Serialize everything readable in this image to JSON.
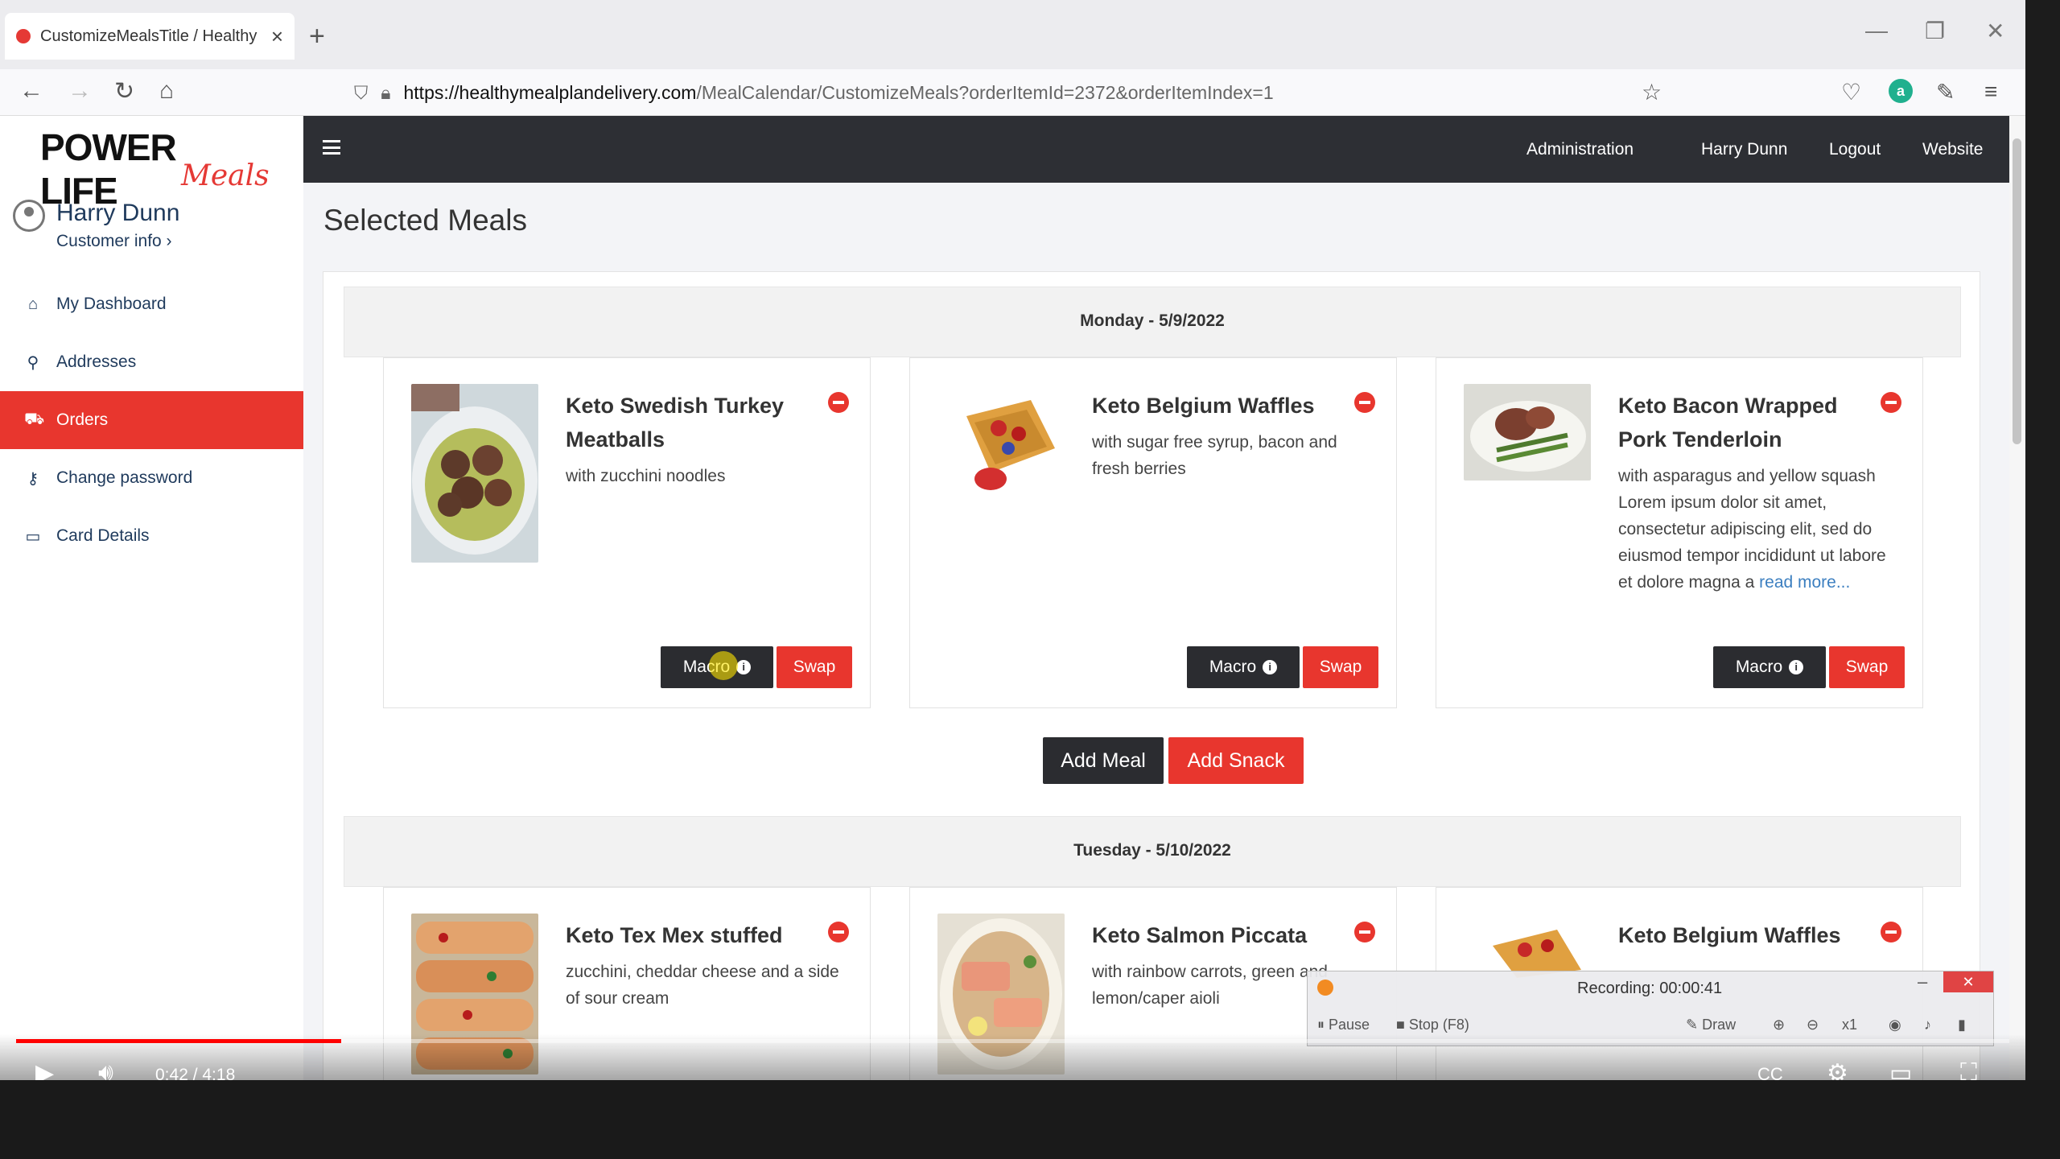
{
  "browser": {
    "tab_title": "CustomizeMealsTitle / Healthy",
    "url_host": "https://healthymealplandelivery.com",
    "url_path": "/MealCalendar/CustomizeMeals?orderItemId=2372&orderItemIndex=1"
  },
  "sidebar": {
    "logo_main": "POWER LIFE",
    "logo_sub": "Meals",
    "user_name": "Harry Dunn",
    "customer_info": "Customer info ›",
    "items": [
      {
        "label": "My Dashboard",
        "icon": "home-icon"
      },
      {
        "label": "Addresses",
        "icon": "map-pin-icon"
      },
      {
        "label": "Orders",
        "icon": "cart-icon"
      },
      {
        "label": "Change password",
        "icon": "key-icon"
      },
      {
        "label": "Card Details",
        "icon": "credit-card-icon"
      }
    ]
  },
  "appbar": {
    "links": [
      "Administration",
      "Harry Dunn",
      "Logout",
      "Website"
    ]
  },
  "page": {
    "title": "Selected Meals"
  },
  "days": [
    {
      "label": "Monday - 5/9/2022",
      "meals": [
        {
          "title": "Keto Swedish Turkey Meatballs",
          "desc": "with zucchini noodles"
        },
        {
          "title": "Keto Belgium Waffles",
          "desc": "with sugar free syrup, bacon and fresh berries"
        },
        {
          "title": "Keto Bacon Wrapped Pork Tenderloin",
          "desc": "with asparagus and yellow squash Lorem ipsum dolor sit amet, consectetur adipiscing elit, sed do eiusmod tempor incididunt ut labore et dolore magna a",
          "read_more": "read more..."
        }
      ]
    },
    {
      "label": "Tuesday - 5/10/2022",
      "meals": [
        {
          "title": "Keto Tex Mex stuffed",
          "desc": "zucchini, cheddar cheese and a side of sour cream"
        },
        {
          "title": "Keto Salmon Piccata",
          "desc": "with rainbow carrots, green and lemon/caper aioli"
        },
        {
          "title": "Keto Belgium Waffles",
          "desc": ""
        }
      ]
    }
  ],
  "buttons": {
    "macro": "Macro",
    "swap": "Swap",
    "add_meal": "Add Meal",
    "add_snack": "Add Snack"
  },
  "recorder": {
    "title": "Recording:  00:00:41",
    "pause": "Pause",
    "stop": "Stop (F8)",
    "draw": "Draw",
    "zoom": "x1"
  },
  "video": {
    "time": "0:42 / 4:18",
    "progress": 0.163
  },
  "colors": {
    "accent_red": "#e8362e",
    "dark": "#2b2c30",
    "appbar": "#2d2f34"
  }
}
